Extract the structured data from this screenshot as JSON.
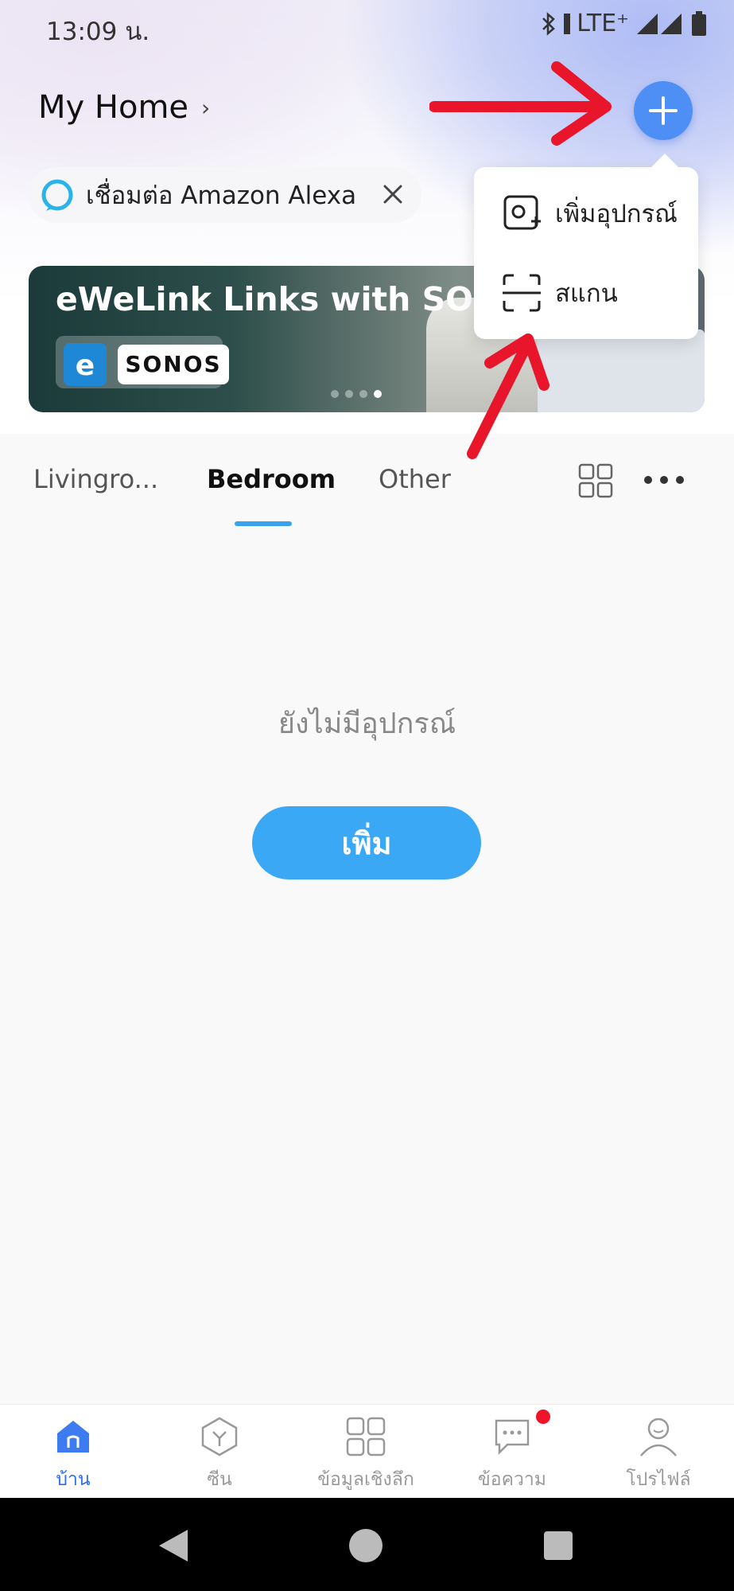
{
  "status_bar": {
    "time": "13:09 น.",
    "network": "LTE⁺"
  },
  "header": {
    "home_name": "My Home",
    "home_chevron": "›"
  },
  "alexa_chip": {
    "label": "เชื่อมต่อ Amazon Alexa"
  },
  "banner": {
    "title": "eWeLink Links with SONOS",
    "logo_text": "e",
    "brand": "SONOS"
  },
  "add_menu": {
    "items": [
      {
        "label": "เพิ่มอุปกรณ์",
        "icon": "add-device-icon"
      },
      {
        "label": "สแกน",
        "icon": "scan-icon"
      }
    ]
  },
  "room_tabs": {
    "items": [
      "Livingro...",
      "Bedroom",
      "Other"
    ],
    "active": "Bedroom"
  },
  "main": {
    "empty_text": "ยังไม่มีอุปกรณ์",
    "add_button": "เพิ่ม"
  },
  "bottom_nav": {
    "items": [
      {
        "label": "บ้าน",
        "icon": "home-icon",
        "active": true
      },
      {
        "label": "ซีน",
        "icon": "scene-icon"
      },
      {
        "label": "ข้อมูลเชิงลึก",
        "icon": "insights-icon"
      },
      {
        "label": "ข้อความ",
        "icon": "message-icon",
        "badge": true
      },
      {
        "label": "โปรไฟล์",
        "icon": "profile-icon"
      }
    ]
  },
  "colors": {
    "accent": "#3aa8f5",
    "primary_blue": "#4d8ff5",
    "annotation_red": "#e8152b"
  }
}
